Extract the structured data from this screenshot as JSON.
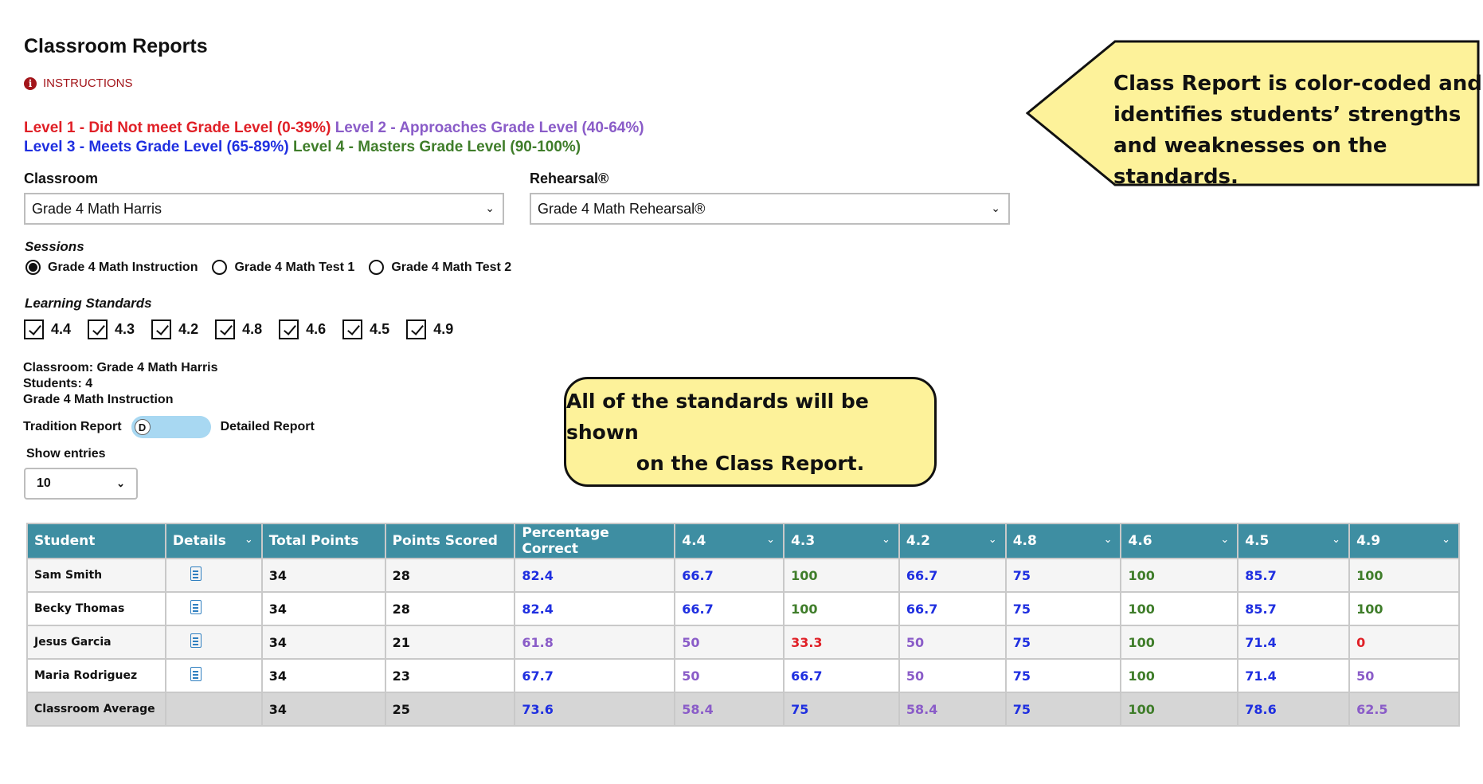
{
  "page": {
    "title": "Classroom Reports",
    "instructions_label": "INSTRUCTIONS"
  },
  "levels": {
    "level1": "Level 1 - Did Not meet Grade Level (0-39%)",
    "level2": "Level 2 - Approaches Grade Level (40-64%)",
    "level3": "Level 3 - Meets Grade Level (65-89%)",
    "level4": "Level 4 - Masters Grade Level (90-100%)"
  },
  "colors": {
    "level1": "#e02027",
    "level2": "#8a5cc8",
    "level3": "#1f2fe0",
    "level4": "#3f7d2a",
    "header": "#3e8ea2",
    "callout": "#fdf29a"
  },
  "classroom": {
    "label": "Classroom",
    "value": "Grade 4 Math Harris"
  },
  "rehearsal": {
    "label": "Rehearsal®",
    "value": "Grade 4 Math Rehearsal®"
  },
  "sessions": {
    "label": "Sessions",
    "options": [
      "Grade 4 Math Instruction",
      "Grade 4 Math Test 1",
      "Grade 4 Math Test 2"
    ],
    "selected": "Grade 4 Math Instruction"
  },
  "standards": {
    "label": "Learning Standards",
    "items": [
      "4.4",
      "4.3",
      "4.2",
      "4.8",
      "4.6",
      "4.5",
      "4.9"
    ]
  },
  "summary": {
    "classroom": "Classroom: Grade 4 Math Harris",
    "students": "Students: 4",
    "session": "Grade 4 Math Instruction"
  },
  "toggle": {
    "left_label": "Tradition Report",
    "knob": "D",
    "right_label": "Detailed Report"
  },
  "entries": {
    "label": "Show entries",
    "value": "10"
  },
  "table": {
    "headers": [
      "Student",
      "Details",
      "Total Points",
      "Points Scored",
      "Percentage Correct",
      "4.4",
      "4.3",
      "4.2",
      "4.8",
      "4.6",
      "4.5",
      "4.9"
    ],
    "rows": [
      {
        "student": "Sam Smith",
        "total": "34",
        "scored": "28",
        "cells": [
          [
            "82.4",
            "l3"
          ],
          [
            "66.7",
            "l3"
          ],
          [
            "100",
            "l4"
          ],
          [
            "66.7",
            "l3"
          ],
          [
            "75",
            "l3"
          ],
          [
            "100",
            "l4"
          ],
          [
            "85.7",
            "l3"
          ],
          [
            "100",
            "l4"
          ]
        ]
      },
      {
        "student": "Becky Thomas",
        "total": "34",
        "scored": "28",
        "cells": [
          [
            "82.4",
            "l3"
          ],
          [
            "66.7",
            "l3"
          ],
          [
            "100",
            "l4"
          ],
          [
            "66.7",
            "l3"
          ],
          [
            "75",
            "l3"
          ],
          [
            "100",
            "l4"
          ],
          [
            "85.7",
            "l3"
          ],
          [
            "100",
            "l4"
          ]
        ]
      },
      {
        "student": "Jesus Garcia",
        "total": "34",
        "scored": "21",
        "cells": [
          [
            "61.8",
            "l2"
          ],
          [
            "50",
            "l2"
          ],
          [
            "33.3",
            "l1"
          ],
          [
            "50",
            "l2"
          ],
          [
            "75",
            "l3"
          ],
          [
            "100",
            "l4"
          ],
          [
            "71.4",
            "l3"
          ],
          [
            "0",
            "l1"
          ]
        ]
      },
      {
        "student": "Maria Rodriguez",
        "total": "34",
        "scored": "23",
        "cells": [
          [
            "67.7",
            "l3"
          ],
          [
            "50",
            "l2"
          ],
          [
            "66.7",
            "l3"
          ],
          [
            "50",
            "l2"
          ],
          [
            "75",
            "l3"
          ],
          [
            "100",
            "l4"
          ],
          [
            "71.4",
            "l3"
          ],
          [
            "50",
            "l2"
          ]
        ]
      }
    ],
    "average": {
      "student": "Classroom Average",
      "total": "34",
      "scored": "25",
      "cells": [
        [
          "73.6",
          "l3"
        ],
        [
          "58.4",
          "l2"
        ],
        [
          "75",
          "l3"
        ],
        [
          "58.4",
          "l2"
        ],
        [
          "75",
          "l3"
        ],
        [
          "100",
          "l4"
        ],
        [
          "78.6",
          "l3"
        ],
        [
          "62.5",
          "l2"
        ]
      ]
    }
  },
  "callouts": {
    "top": [
      "Class Report is color-coded and",
      "identifies students’ strengths",
      "and weaknesses on the standards."
    ],
    "middle": [
      "All of the standards will be shown",
      "on the Class Report."
    ]
  }
}
